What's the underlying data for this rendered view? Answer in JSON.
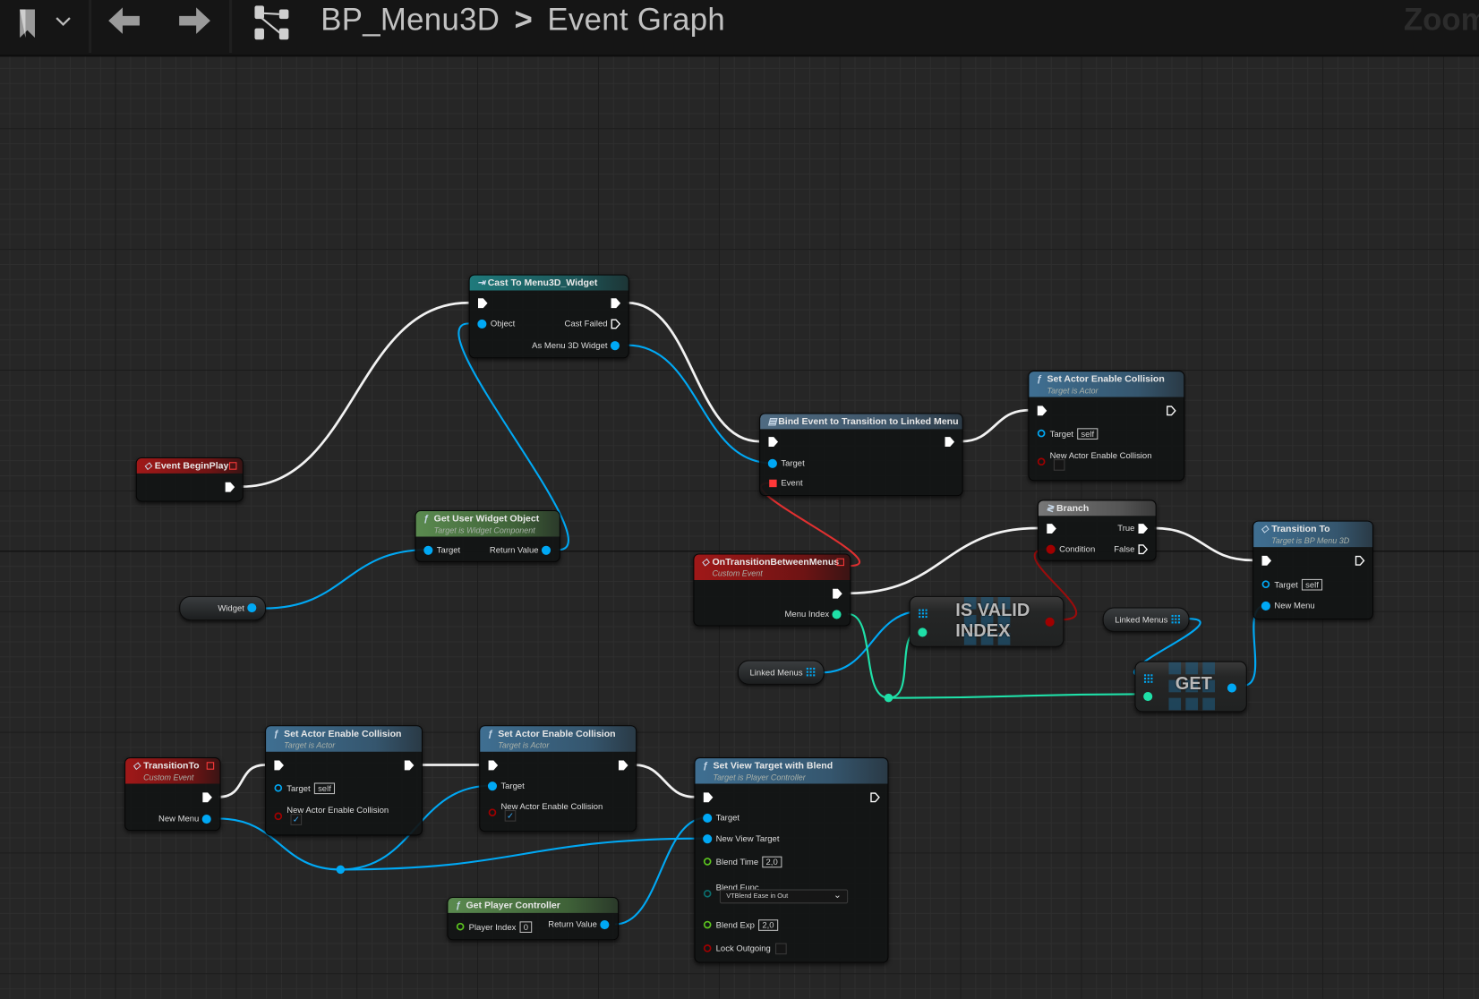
{
  "toolbar": {
    "blueprint": "BP_Menu3D",
    "separator": ">",
    "graph": "Event Graph",
    "zoom_label": "Zoom"
  },
  "nodes": {
    "cast": {
      "title": "Cast To Menu3D_Widget",
      "pins": {
        "object": "Object",
        "cast_failed": "Cast Failed",
        "as_widget": "As Menu 3D Widget"
      }
    },
    "beginplay": {
      "title": "Event BeginPlay"
    },
    "getwidget": {
      "title": "Get User Widget Object",
      "subtitle": "Target is Widget Component",
      "pins": {
        "target": "Target",
        "return_value": "Return Value"
      }
    },
    "bind": {
      "title": "Bind Event to Transition to Linked Menu",
      "pins": {
        "target": "Target",
        "event": "Event"
      }
    },
    "sac_top": {
      "title": "Set Actor Enable Collision",
      "subtitle": "Target is Actor",
      "pins": {
        "target": "Target",
        "target_value": "self",
        "nac": "New Actor Enable Collision"
      },
      "checked": false
    },
    "branch": {
      "title": "Branch",
      "pins": {
        "true": "True",
        "condition": "Condition",
        "false": "False"
      }
    },
    "transition_to": {
      "title": "Transition To",
      "subtitle": "Target is BP Menu 3D",
      "pins": {
        "target": "Target",
        "target_value": "self",
        "new_menu": "New Menu"
      }
    },
    "on_transition": {
      "title": "OnTransitionBetweenMenus",
      "subtitle": "Custom Event",
      "pins": {
        "menu_index": "Menu Index"
      }
    },
    "transition_event": {
      "title": "TransitionTo",
      "subtitle": "Custom Event",
      "pins": {
        "new_menu": "New Menu"
      }
    },
    "sac1": {
      "title": "Set Actor Enable Collision",
      "subtitle": "Target is Actor",
      "pins": {
        "target": "Target",
        "target_value": "self",
        "nac": "New Actor Enable Collision"
      },
      "checked": true
    },
    "sac2": {
      "title": "Set Actor Enable Collision",
      "subtitle": "Target is Actor",
      "pins": {
        "target": "Target",
        "nac": "New Actor Enable Collision"
      },
      "checked": true
    },
    "svt": {
      "title": "Set View Target with Blend",
      "subtitle": "Target is Player Controller",
      "pins": {
        "target": "Target",
        "new_view_target": "New View Target",
        "blend_time": "Blend Time",
        "blend_time_value": "2,0",
        "blend_func": "Blend Func",
        "blend_func_value": "VTBlend Ease in Out",
        "blend_exp": "Blend Exp",
        "blend_exp_value": "2,0",
        "lock_outgoing": "Lock Outgoing"
      },
      "lock_checked": false
    },
    "getpc": {
      "title": "Get Player Controller",
      "pins": {
        "player_index": "Player Index",
        "player_index_value": "0",
        "return_value": "Return Value"
      }
    },
    "is_valid": {
      "line1": "IS VALID",
      "line2": "INDEX"
    },
    "get": {
      "label": "GET"
    },
    "var_widget": {
      "label": "Widget"
    },
    "var_linked_1": {
      "label": "Linked Menus"
    },
    "var_linked_2": {
      "label": "Linked Menus"
    }
  },
  "colors": {
    "exec": "#ffffff",
    "object": "#00a8f4",
    "int": "#1fe0a8",
    "bool": "#a00000",
    "float": "#5cc51f",
    "delegate": "#ff3838",
    "byte": "#0a6e6e"
  }
}
